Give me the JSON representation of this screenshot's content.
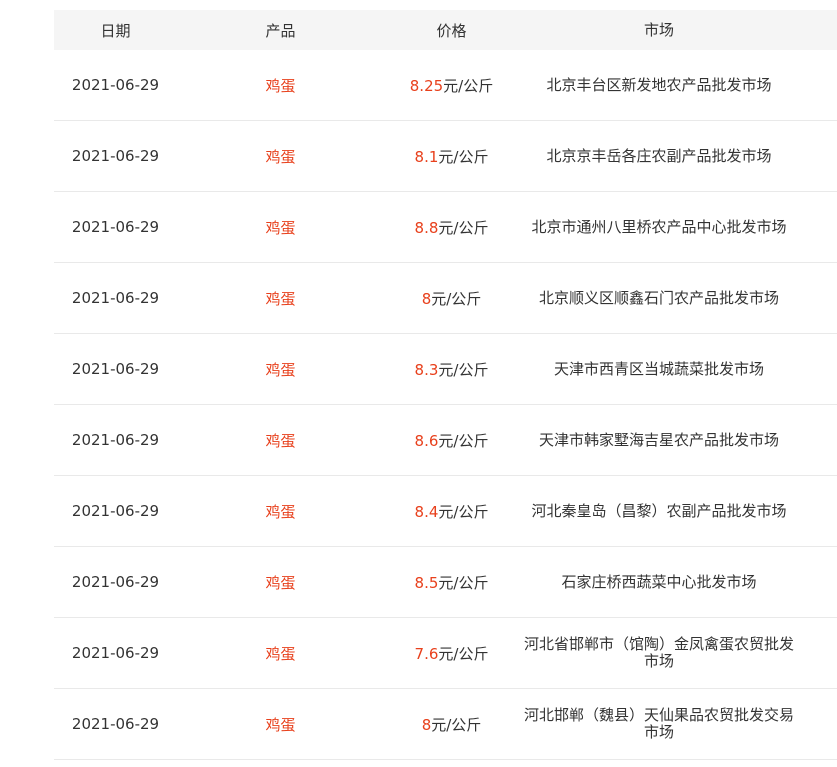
{
  "table": {
    "headers": [
      "日期",
      "产品",
      "价格",
      "市场"
    ],
    "rows": [
      {
        "date": "2021-06-29",
        "product": "鸡蛋",
        "price": "8.25",
        "unit": "元/公斤",
        "market": "北京丰台区新发地农产品批发市场"
      },
      {
        "date": "2021-06-29",
        "product": "鸡蛋",
        "price": "8.1",
        "unit": "元/公斤",
        "market": "北京京丰岳各庄农副产品批发市场"
      },
      {
        "date": "2021-06-29",
        "product": "鸡蛋",
        "price": "8.8",
        "unit": "元/公斤",
        "market": "北京市通州八里桥农产品中心批发市场"
      },
      {
        "date": "2021-06-29",
        "product": "鸡蛋",
        "price": "8",
        "unit": "元/公斤",
        "market": "北京顺义区顺鑫石门农产品批发市场"
      },
      {
        "date": "2021-06-29",
        "product": "鸡蛋",
        "price": "8.3",
        "unit": "元/公斤",
        "market": "天津市西青区当城蔬菜批发市场"
      },
      {
        "date": "2021-06-29",
        "product": "鸡蛋",
        "price": "8.6",
        "unit": "元/公斤",
        "market": "天津市韩家墅海吉星农产品批发市场"
      },
      {
        "date": "2021-06-29",
        "product": "鸡蛋",
        "price": "8.4",
        "unit": "元/公斤",
        "market": "河北秦皇岛（昌黎）农副产品批发市场"
      },
      {
        "date": "2021-06-29",
        "product": "鸡蛋",
        "price": "8.5",
        "unit": "元/公斤",
        "market": "石家庄桥西蔬菜中心批发市场"
      },
      {
        "date": "2021-06-29",
        "product": "鸡蛋",
        "price": "7.6",
        "unit": "元/公斤",
        "market": "河北省邯郸市（馆陶）金凤禽蛋农贸批发市场"
      },
      {
        "date": "2021-06-29",
        "product": "鸡蛋",
        "price": "8",
        "unit": "元/公斤",
        "market": "河北邯郸（魏县）天仙果品农贸批发交易市场"
      }
    ]
  },
  "colors": {
    "accent": "#e8401c",
    "header_bg": "#f5f5f5",
    "text": "#333333",
    "divider": "#e9e9e9"
  }
}
